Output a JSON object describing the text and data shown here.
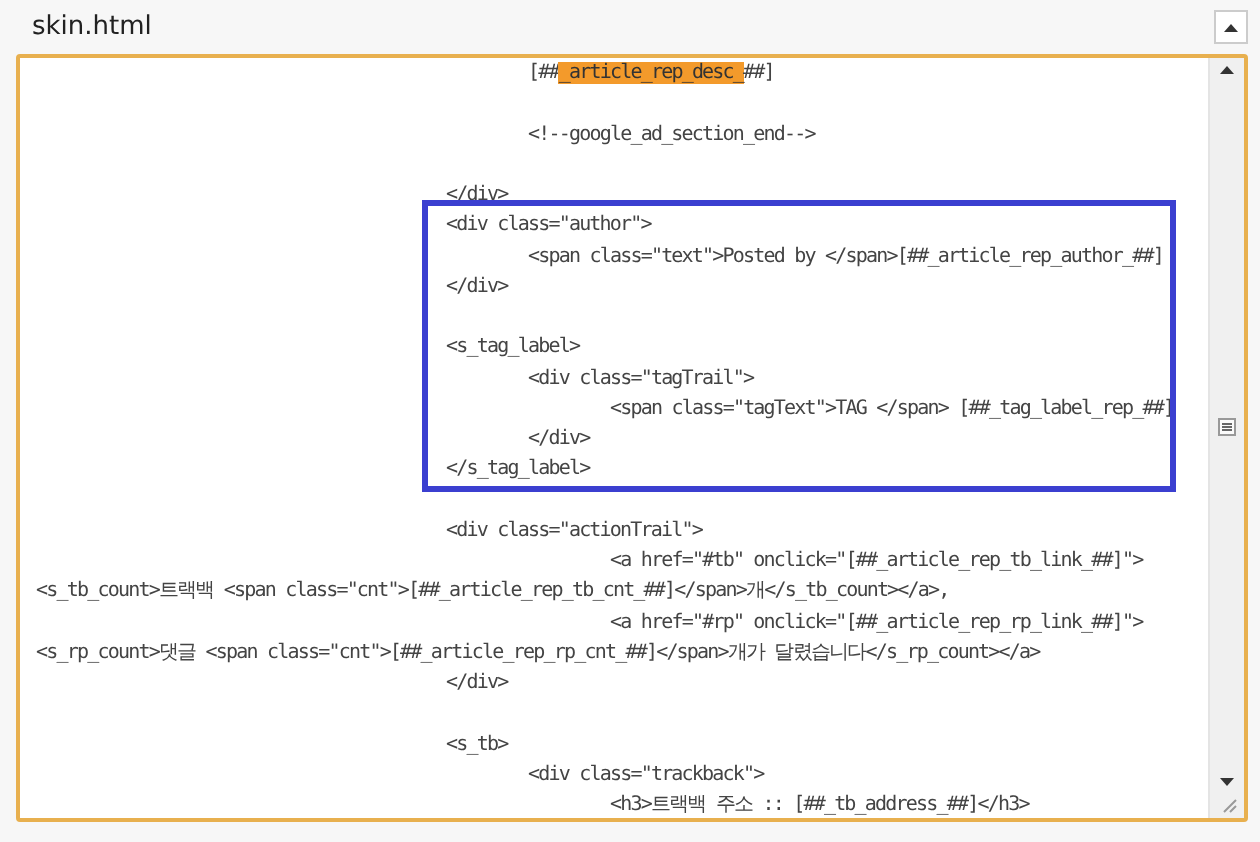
{
  "panel": {
    "title": "skin.html"
  },
  "editor": {
    "sections": [
      {
        "boxed": false,
        "lines": [
          {
            "text": "\t\t\t\t\t\t[##",
            "highlight": "_article_rep_desc_",
            "after": "##]"
          },
          {
            "text": "\n\t\t\t\t\t\t<!--google_ad_section_end-->"
          },
          {
            "text": "\n\t\t\t\t\t</div>"
          }
        ]
      },
      {
        "boxed": true,
        "lines": [
          {
            "text": "\t\t\t\t\t<div class=\"author\">"
          },
          {
            "text": "\t\t\t\t\t\t<span class=\"text\">Posted by </span>[##_article_rep_author_##]"
          },
          {
            "text": "\t\t\t\t\t</div>"
          },
          {
            "text": "\n\t\t\t\t\t<s_tag_label>"
          },
          {
            "text": "\t\t\t\t\t\t<div class=\"tagTrail\">"
          },
          {
            "text": "\t\t\t\t\t\t\t<span class=\"tagText\">TAG </span> [##_tag_label_rep_##]"
          },
          {
            "text": "\t\t\t\t\t\t</div>"
          },
          {
            "text": "\t\t\t\t\t</s_tag_label>"
          }
        ]
      },
      {
        "boxed": false,
        "lines": [
          {
            "text": "\n\t\t\t\t\t<div class=\"actionTrail\">"
          },
          {
            "text": "\t\t\t\t\t\t\t<a href=\"#tb\" onclick=\"[##_article_rep_tb_link_##]\">"
          },
          {
            "text": "<s_tb_count>트랙백 <span class=\"cnt\">[##_article_rep_tb_cnt_##]</span>개</s_tb_count></a>,"
          },
          {
            "text": "\t\t\t\t\t\t\t<a href=\"#rp\" onclick=\"[##_article_rep_rp_link_##]\">"
          },
          {
            "text": "<s_rp_count>댓글 <span class=\"cnt\">[##_article_rep_rp_cnt_##]</span>개가 달렸습니다</s_rp_count></a>"
          },
          {
            "text": "\t\t\t\t\t</div>"
          },
          {
            "text": "\n\t\t\t\t\t<s_tb>"
          },
          {
            "text": "\t\t\t\t\t\t<div class=\"trackback\">"
          },
          {
            "text": "\t\t\t\t\t\t\t<h3>트랙백 주소 :: [##_tb_address_##]</h3>"
          }
        ]
      }
    ]
  }
}
